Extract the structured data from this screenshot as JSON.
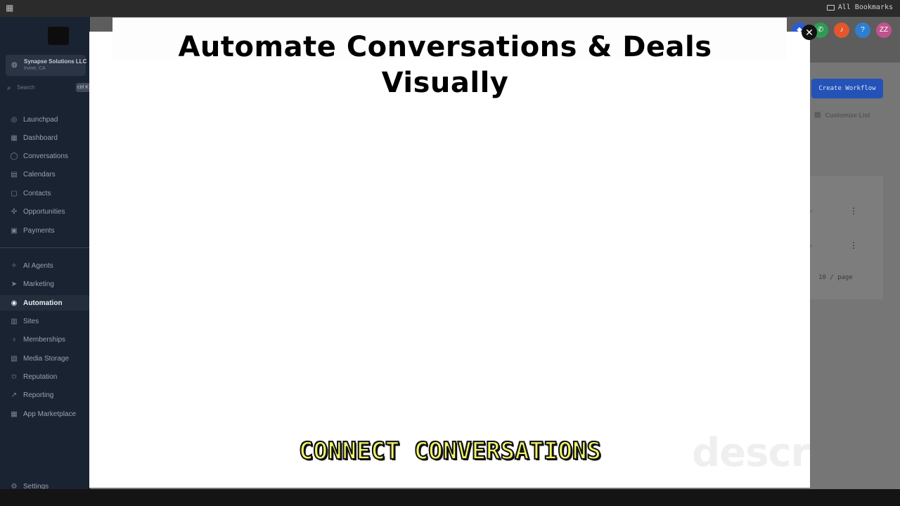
{
  "browser": {
    "bookmarks_label": "All Bookmarks"
  },
  "sidebar": {
    "account_name": "Synapse Solutions LLC",
    "account_location": "Irvine, CA",
    "search_placeholder": "Search",
    "search_shortcut": "ctrl K",
    "items": [
      {
        "label": "Launchpad",
        "icon": "rocket-icon"
      },
      {
        "label": "Dashboard",
        "icon": "grid-icon"
      },
      {
        "label": "Conversations",
        "icon": "chat-icon"
      },
      {
        "label": "Calendars",
        "icon": "calendar-icon"
      },
      {
        "label": "Contacts",
        "icon": "contacts-icon"
      },
      {
        "label": "Opportunities",
        "icon": "opportunities-icon"
      },
      {
        "label": "Payments",
        "icon": "payments-icon"
      },
      {
        "label": "AI Agents",
        "icon": "sparkle-icon"
      },
      {
        "label": "Marketing",
        "icon": "send-icon"
      },
      {
        "label": "Automation",
        "icon": "automation-icon"
      },
      {
        "label": "Sites",
        "icon": "sites-icon"
      },
      {
        "label": "Memberships",
        "icon": "memberships-icon"
      },
      {
        "label": "Media Storage",
        "icon": "media-icon"
      },
      {
        "label": "Reputation",
        "icon": "reputation-icon"
      },
      {
        "label": "Reporting",
        "icon": "chart-icon"
      },
      {
        "label": "App Marketplace",
        "icon": "marketplace-icon"
      }
    ],
    "settings_label": "Settings",
    "active_item": "Automation"
  },
  "main": {
    "create_button_label": "Create Workflow",
    "customize_label": "Customize List",
    "pager_label": "10 / page"
  },
  "modal": {
    "title_line1": "Automate Conversations & Deals",
    "title_line2": "Visually",
    "close_label": "✕"
  },
  "caption": {
    "text": "CONNECT CONVERSATIONS"
  },
  "watermark": {
    "text": "descript"
  },
  "colors": {
    "accent": "#2453b8",
    "caption_fill": "#f1f56a",
    "sidebar_bg": "#1a2332"
  }
}
